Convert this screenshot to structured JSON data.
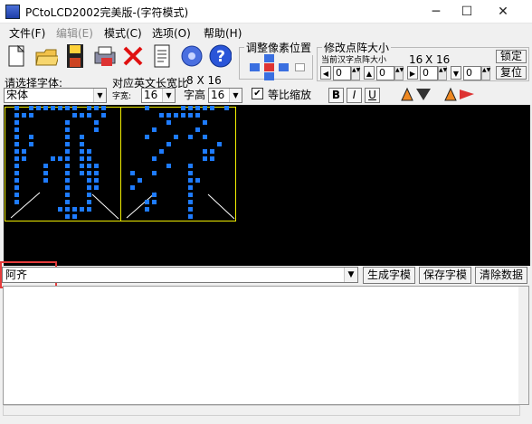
{
  "window": {
    "title": "PCtoLCD2002完美版-(字符模式)",
    "min_glyph": "─",
    "max_glyph": "☐",
    "close_glyph": "✕"
  },
  "menu": [
    "文件(F)",
    "编辑(E)",
    "模式(C)",
    "选项(O)",
    "帮助(H)"
  ],
  "pixel_group": {
    "title": "调整像素位置"
  },
  "dot_group": {
    "title": "修改点阵大小",
    "current_label": "当前汉字点阵大小",
    "size_a": "16",
    "x_label": "X",
    "size_b": "16",
    "lock": "锁定",
    "restore": "复位",
    "spin_values": [
      "0",
      "0",
      "0",
      "0"
    ]
  },
  "font": {
    "select_label": "请选择字体:",
    "font_name": "宋体",
    "en_width_label": "对应英文长宽比",
    "en_ratio": "8 X 16",
    "width_label": "字宽:",
    "width_value": "16",
    "height_label": "字高",
    "height_value": "16",
    "scale_label": "等比缩放",
    "scale_checked": "✔",
    "bold": "B",
    "italic": "I",
    "underline": "U"
  },
  "input": {
    "text": "阿齐",
    "arrow": "▼"
  },
  "buttons": {
    "generate": "生成字模",
    "save": "保存字模",
    "clear": "清除数据"
  },
  "colors": {
    "pixel": "#1e7bff",
    "grid": "#f2f000",
    "highlight": "#e53b3b"
  }
}
